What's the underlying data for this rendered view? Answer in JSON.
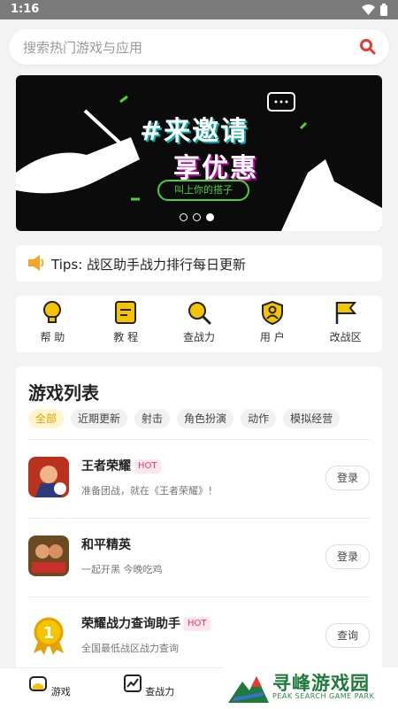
{
  "status": {
    "time": "1:16",
    "icons": [
      "wifi-icon",
      "battery-icon"
    ]
  },
  "search": {
    "placeholder": "搜索热门游戏与应用",
    "icon": "search-icon"
  },
  "banner": {
    "line1": "#来邀请",
    "line2": "享优惠",
    "tag": "叫上你的搭子",
    "dots": 3,
    "active_dot": 3
  },
  "tips": {
    "text": "Tips: 战区助手战力排行每日更新",
    "icon": "speaker-icon"
  },
  "quick": [
    {
      "label": "帮 助",
      "icon": "lightbulb-icon"
    },
    {
      "label": "教 程",
      "icon": "book-icon"
    },
    {
      "label": "查战力",
      "icon": "magnifier-icon"
    },
    {
      "label": "用 户",
      "icon": "user-shield-icon"
    },
    {
      "label": "改战区",
      "icon": "flag-icon"
    }
  ],
  "games": {
    "title": "游戏列表",
    "chips": [
      "全部",
      "近期更新",
      "射击",
      "角色扮演",
      "动作",
      "模拟经营"
    ],
    "active_chip": "全部",
    "items": [
      {
        "name": "王者荣耀",
        "hot": "HOT",
        "desc": "准备团战，就在《王者荣耀》！",
        "button": "登录",
        "icon": "game-icon-honor"
      },
      {
        "name": "和平精英",
        "hot": "",
        "desc": "一起开黑 今晚吃鸡",
        "button": "登录",
        "icon": "game-icon-peace"
      },
      {
        "name": "荣耀战力查询助手",
        "hot": "HOT",
        "desc": "全国最低战区战力查询",
        "button": "查询",
        "icon": "medal-icon"
      }
    ]
  },
  "nav": [
    {
      "label": "游戏",
      "icon": "gamepad-icon"
    },
    {
      "label": "查战力",
      "icon": "chart-icon"
    }
  ],
  "watermark": {
    "title": "寻峰游戏园",
    "subtitle": "PEAK SEARCH GAME PARK"
  },
  "colors": {
    "accent": "#f5c400",
    "hot": "#e53b6b",
    "search": "#e53935"
  }
}
